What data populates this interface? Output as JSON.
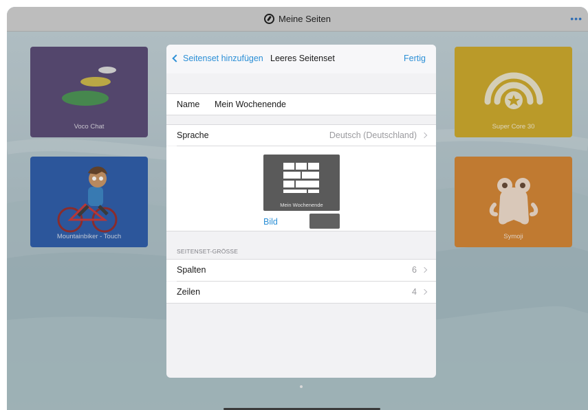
{
  "topbar": {
    "title": "Meine Seiten",
    "more": "•••"
  },
  "tiles": [
    {
      "label": "Voco Chat",
      "color": "#4b3b6a"
    },
    {
      "label": "Mountainbiker - Touch",
      "color": "#1c4fa3"
    },
    {
      "label": "Super Core 30",
      "color": "#c9a118"
    },
    {
      "label": "Symoji",
      "color": "#d07a22"
    }
  ],
  "dialog": {
    "back_label": "Seitenset hinzufügen",
    "title": "Leeres Seitenset",
    "done_label": "Fertig",
    "name_label": "Name",
    "name_value": "Mein Wochenende",
    "language_label": "Sprache",
    "language_value": "Deutsch (Deutschland)",
    "preview_caption": "Mein Wochenende",
    "image_link": "Bild",
    "section_header": "SEITENSET-GRÖSSE",
    "columns_label": "Spalten",
    "columns_value": "6",
    "rows_label": "Zeilen",
    "rows_value": "4"
  },
  "colors": {
    "accent": "#2b8fd6",
    "preview_bg": "#5a5a5a"
  }
}
